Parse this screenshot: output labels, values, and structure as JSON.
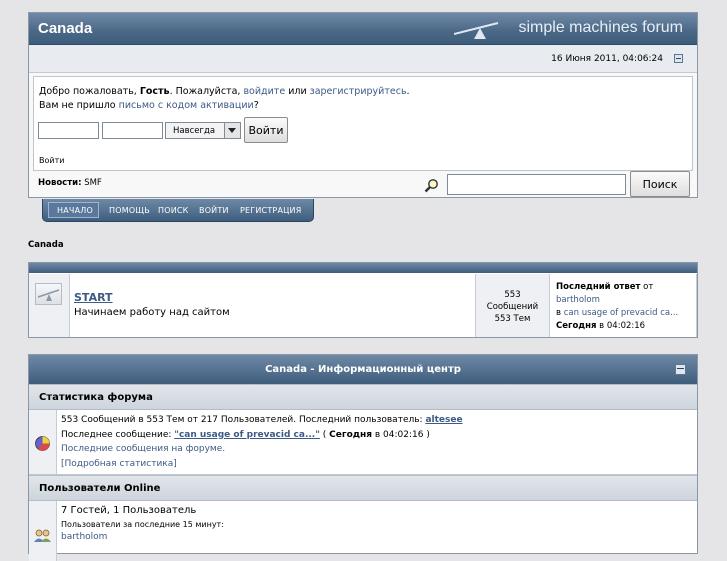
{
  "header": {
    "forum_title": "Canada",
    "brand": "simple machines forum",
    "date": "16 Июня 2011, 04:06:24"
  },
  "userbox": {
    "welcome_pre": "Добро пожаловать, ",
    "guest": "Гость",
    "welcome_mid": ". Пожалуйста, ",
    "login_link": "войдите",
    "or": " или ",
    "register_link": "зарегистрируйтесь",
    "dot": ".",
    "activation_pre": "Вам не пришло ",
    "activation_link": "письмо с кодом активации",
    "activation_post": "?",
    "session_length": "Навсегда",
    "login_button": "Войти",
    "login_caption": "Войти"
  },
  "news": {
    "label": "Новости:",
    "text": "SMF"
  },
  "search": {
    "button": "Поиск",
    "value": ""
  },
  "nav": [
    {
      "label": "НАЧАЛО",
      "active": true
    },
    {
      "label": "ПОМОЩЬ"
    },
    {
      "label": "ПОИСК"
    },
    {
      "label": "ВОЙТИ"
    },
    {
      "label": "РЕГИСТРАЦИЯ"
    }
  ],
  "breadcrumb": "Canada",
  "board": {
    "name": "START",
    "description": "Начинаем работу над сайтом",
    "posts": "553",
    "posts_label": "Сообщений",
    "topics": "553 Тем",
    "last_label": "Последний ответ",
    "last_from": " от",
    "last_user": "bartholom",
    "last_in": "в",
    "last_topic": "can usage of prevacid ca...",
    "last_day": "Сегодня",
    "last_time": " в 04:02:16"
  },
  "info": {
    "title": "Canada - Информационный центр",
    "stats_head": "Статистика форума",
    "stats_line1": "553 Сообщений в 553 Тем от 217 Пользователей. Последний пользователь:",
    "latest_member": "altesee",
    "stats_line2_pre": "Последнее сообщение: ",
    "latest_post": "\"can usage of prevacid ca...\"",
    "stats_line2_mid": " ( ",
    "today": "Сегодня",
    "stats_line2_post": " в 04:02:16 )",
    "recent_link": "Последние сообщения на форуме.",
    "detail_link": "[Подробная статистика]",
    "online_head": "Пользователи Online",
    "online_line1": "7 Гостей, 1 Пользователь",
    "online_line2": "Пользователи за последние 15 минут:",
    "online_user": "bartholom"
  }
}
